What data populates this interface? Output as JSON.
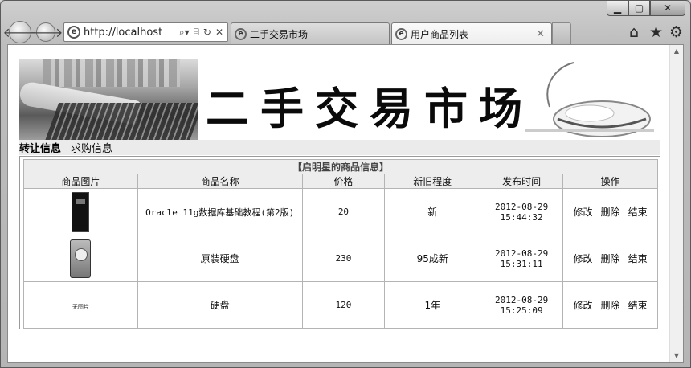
{
  "browser": {
    "address": "http://localhost",
    "tabs": [
      {
        "label": "二手交易市场"
      },
      {
        "label": "用户商品列表"
      }
    ],
    "window_controls": {
      "minimize": "▁",
      "maximize": "▢",
      "close": "✕"
    },
    "address_tools": {
      "search": "⌕▾",
      "compat": "⌸",
      "refresh": "↻",
      "stop": "✕"
    },
    "tab_close": "✕",
    "icons": {
      "back": "🡐",
      "forward": "🡒",
      "home": "⌂",
      "favorites": "★",
      "tools": "⚙",
      "scroll_up": "▲",
      "scroll_down": "▼"
    }
  },
  "page": {
    "banner_title": "二手交易市场",
    "nav": {
      "current": "转让信息",
      "other": "求购信息"
    },
    "table": {
      "caption": "【启明星的商品信息】",
      "headers": [
        "商品图片",
        "商品名称",
        "价格",
        "新旧程度",
        "发布时间",
        "操作"
      ],
      "rows": [
        {
          "image": "book",
          "name": "Oracle 11g数据库基础教程(第2版)",
          "price": "20",
          "condition": "新",
          "date": "2012-08-29",
          "time": "15:44:32"
        },
        {
          "image": "hdd",
          "name": "原装硬盘",
          "price": "230",
          "condition": "95成新",
          "date": "2012-08-29",
          "time": "15:31:11"
        },
        {
          "image": "alt",
          "image_alt": "无图片",
          "name": "硬盘",
          "price": "120",
          "condition": "1年",
          "date": "2012-08-29",
          "time": "15:25:09"
        }
      ],
      "actions": {
        "edit": "修改",
        "delete": "删除",
        "finish": "结束"
      }
    }
  }
}
